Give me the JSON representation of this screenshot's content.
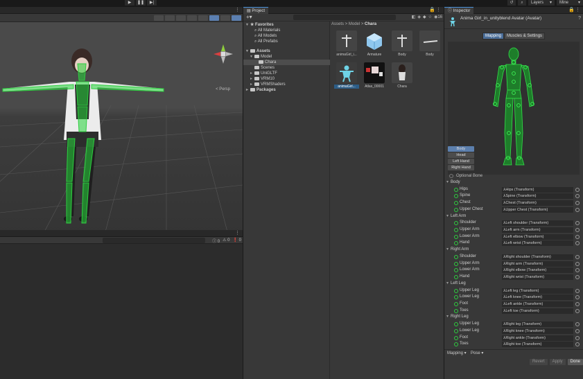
{
  "toolbar": {
    "play_icons": [
      "▶",
      "❚❚",
      "▶|"
    ],
    "layers_label": "Layers",
    "layout_label": "Mine"
  },
  "scene": {
    "persp_label": "< Persp"
  },
  "console": {
    "counts": [
      "0",
      "0",
      "0"
    ]
  },
  "project": {
    "tab": "Project",
    "add_label": "+",
    "hidden_count": "16",
    "tree": [
      {
        "label": "Favorites",
        "level": 0,
        "icon": "star",
        "open": true,
        "bold": true
      },
      {
        "label": "All Materials",
        "level": 1,
        "icon": "search"
      },
      {
        "label": "All Models",
        "level": 1,
        "icon": "search"
      },
      {
        "label": "All Prefabs",
        "level": 1,
        "icon": "search"
      },
      {
        "label": "Assets",
        "level": 0,
        "icon": "folder",
        "open": true,
        "bold": true
      },
      {
        "label": "Model",
        "level": 1,
        "icon": "folder",
        "open": true
      },
      {
        "label": "Chara",
        "level": 2,
        "icon": "folder",
        "selected": true
      },
      {
        "label": "Scenes",
        "level": 1,
        "icon": "folder"
      },
      {
        "label": "UniGLTF",
        "level": 1,
        "icon": "folder",
        "closed": true
      },
      {
        "label": "VRM10",
        "level": 1,
        "icon": "folder",
        "closed": true
      },
      {
        "label": "VRMShaders",
        "level": 1,
        "icon": "folder",
        "closed": true
      },
      {
        "label": "Packages",
        "level": 0,
        "icon": "folder",
        "closed": true,
        "bold": true
      }
    ],
    "breadcrumb": [
      "Assets",
      "Model",
      "Chara"
    ],
    "assets": [
      {
        "name": "animaGirl_i...",
        "kind": "model"
      },
      {
        "name": "Armature",
        "kind": "cube"
      },
      {
        "name": "Body",
        "kind": "model"
      },
      {
        "name": "Body",
        "kind": "mesh"
      },
      {
        "name": "animaGirl...",
        "kind": "avatar",
        "selected": true
      },
      {
        "name": "Atlas_00001",
        "kind": "texture"
      },
      {
        "name": "Chara",
        "kind": "prefab"
      }
    ]
  },
  "inspector": {
    "tab": "Inspector",
    "title": "Anima Girl_in_unityblend Avatar (Avatar)",
    "tabs": [
      "Mapping",
      "Muscles & Settings"
    ],
    "parts": [
      "Body",
      "Head",
      "Left Hand",
      "Right Hand"
    ],
    "optional_label": "Optional Bone",
    "groups": [
      {
        "name": "Body",
        "bones": [
          {
            "name": "Hips",
            "target": "Hips (Transform)"
          },
          {
            "name": "Spine",
            "target": "Spine (Transform)"
          },
          {
            "name": "Chest",
            "target": "Chest (Transform)"
          },
          {
            "name": "Upper Chest",
            "target": "Upper Chest (Transform)"
          }
        ]
      },
      {
        "name": "Left Arm",
        "bones": [
          {
            "name": "Shoulder",
            "target": "Left shoulder (Transform)"
          },
          {
            "name": "Upper Arm",
            "target": "Left arm (Transform)"
          },
          {
            "name": "Lower Arm",
            "target": "Left elbow (Transform)"
          },
          {
            "name": "Hand",
            "target": "Left wrist (Transform)"
          }
        ]
      },
      {
        "name": "Right Arm",
        "bones": [
          {
            "name": "Shoulder",
            "target": "Right shoulder (Transform)"
          },
          {
            "name": "Upper Arm",
            "target": "Right arm (Transform)"
          },
          {
            "name": "Lower Arm",
            "target": "Right elbow (Transform)"
          },
          {
            "name": "Hand",
            "target": "Right wrist (Transform)"
          }
        ]
      },
      {
        "name": "Left Leg",
        "bones": [
          {
            "name": "Upper Leg",
            "target": "Left leg (Transform)"
          },
          {
            "name": "Lower Leg",
            "target": "Left knee (Transform)"
          },
          {
            "name": "Foot",
            "target": "Left ankle (Transform)"
          },
          {
            "name": "Toes",
            "target": "Left toe (Transform)"
          }
        ]
      },
      {
        "name": "Right Leg",
        "bones": [
          {
            "name": "Upper Leg",
            "target": "Right leg (Transform)"
          },
          {
            "name": "Lower Leg",
            "target": "Right knee (Transform)"
          },
          {
            "name": "Foot",
            "target": "Right ankle (Transform)"
          },
          {
            "name": "Toes",
            "target": "Right toe (Transform)"
          }
        ]
      }
    ],
    "footer": {
      "mapping_label": "Mapping ▾",
      "pose_label": "Pose ▾"
    },
    "buttons": {
      "revert": "Revert",
      "apply": "Apply",
      "done": "Done"
    }
  },
  "colors": {
    "accent": "#4b6e99",
    "bone_green": "#2ecc40",
    "panel": "#383838"
  }
}
